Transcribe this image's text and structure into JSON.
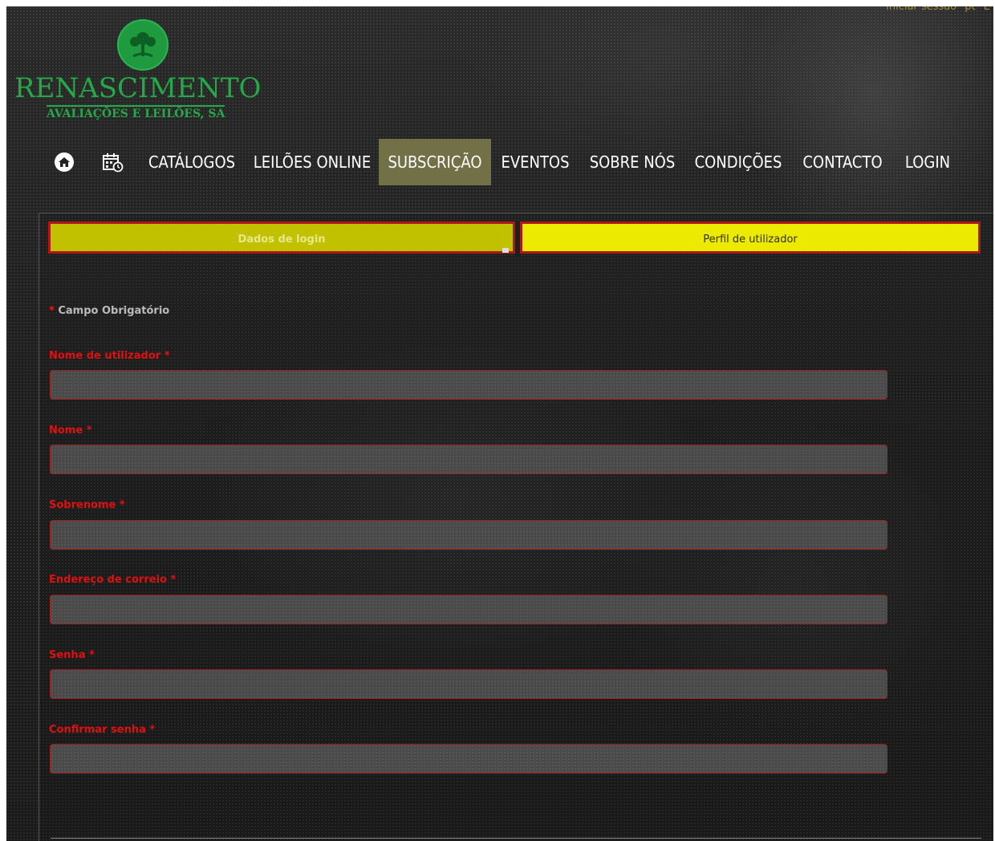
{
  "topbar": {
    "login_link": "Iniciar sessão",
    "lang_pt": "pt",
    "lang_en": "E"
  },
  "logo": {
    "title": "RENASCIMENTO",
    "subtitle": "AVALIAÇÕES E LEILÕES, SA"
  },
  "nav": {
    "home_icon": "home-icon",
    "calendar_icon": "calendar-icon",
    "items": [
      {
        "label": "CATÁLOGOS"
      },
      {
        "label": "LEILÕES ONLINE"
      },
      {
        "label": "SUBSCRIÇÃO",
        "active": true
      },
      {
        "label": "EVENTOS"
      },
      {
        "label": "SOBRE NÓS"
      },
      {
        "label": "CONDIÇÕES"
      },
      {
        "label": "CONTACTO"
      },
      {
        "label": "LOGIN"
      }
    ]
  },
  "tabs": {
    "login_data": "Dados de login",
    "user_profile": "Perfil de utilizador"
  },
  "form": {
    "required_star": "*",
    "required_note": "Campo Obrigatório",
    "fields": [
      {
        "label": "Nome de utilizador *",
        "value": ""
      },
      {
        "label": "Nome *",
        "value": ""
      },
      {
        "label": "Sobrenome *",
        "value": ""
      },
      {
        "label": "Endereço de correio *",
        "value": ""
      },
      {
        "label": "Senha *",
        "value": ""
      },
      {
        "label": "Confirmar senha *",
        "value": ""
      }
    ]
  },
  "colors": {
    "active_nav": "#717046",
    "tab_active": "#c2c100",
    "tab_inactive": "#ebea00",
    "label_red": "#e01010",
    "brand_green": "#27a848"
  }
}
